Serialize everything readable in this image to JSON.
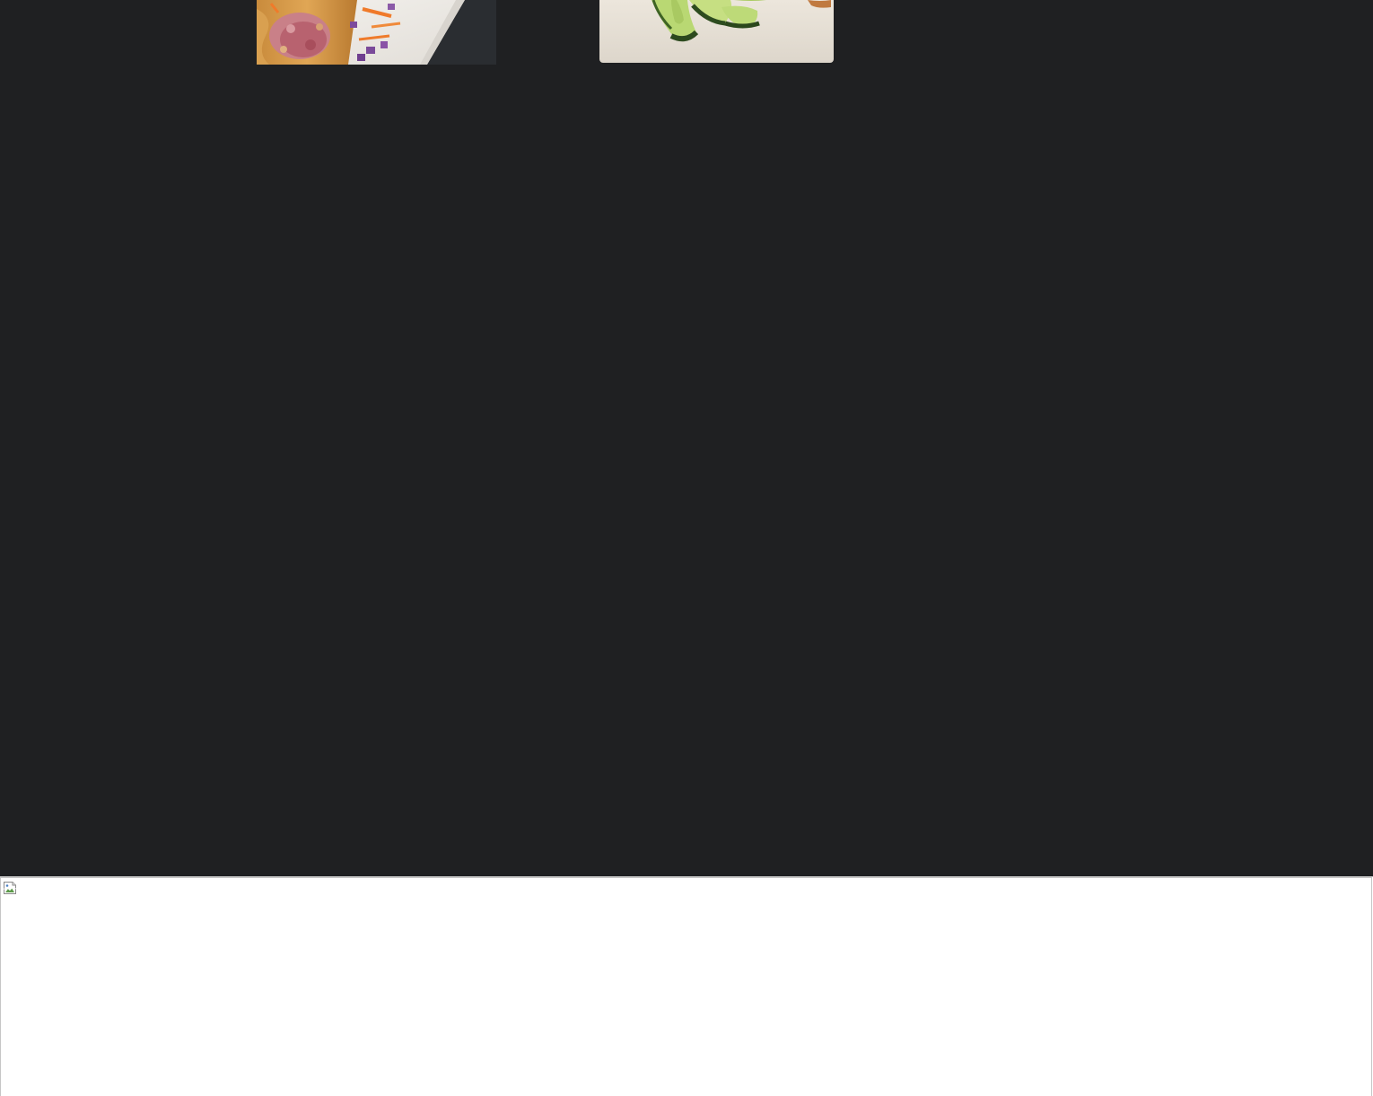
{
  "gallery": {
    "items": [
      {
        "icon": "photo-eggroll-on-plate"
      },
      {
        "icon": "photo-cucumber-salad"
      }
    ]
  },
  "footer": {
    "image_icon": "broken-image-icon"
  },
  "colors": {
    "page_background": "#1f2022",
    "footer_background": "#ffffff"
  }
}
